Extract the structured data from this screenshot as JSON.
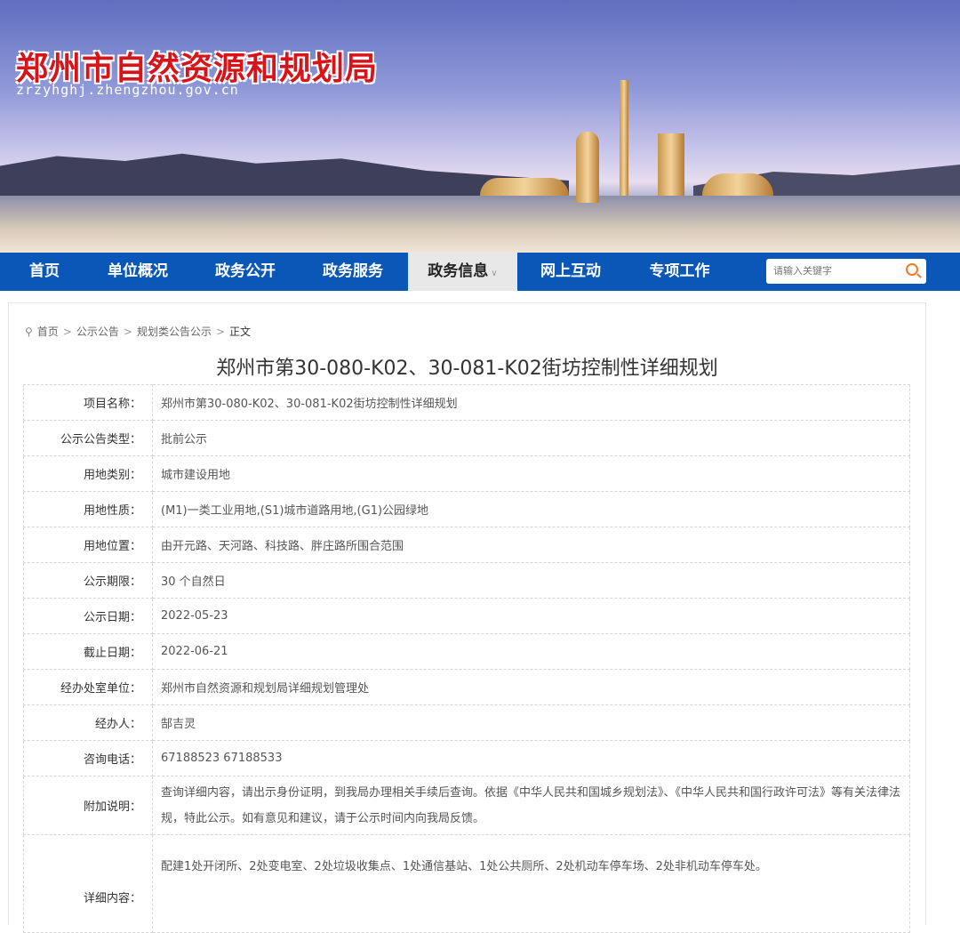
{
  "header": {
    "title": "郑州市自然资源和规划局",
    "domain": "zrzyhghj.zhengzhou.gov.cn"
  },
  "nav": {
    "items": [
      "首页",
      "单位概况",
      "政务公开",
      "政务服务",
      "政务信息",
      "网上互动",
      "专项工作"
    ],
    "search_placeholder": "请输入关键字"
  },
  "breadcrumb": [
    "首页",
    "公示公告",
    "规划类公告公示",
    "正文"
  ],
  "article": {
    "title": "郑州市第30-080-K02、30-081-K02街坊控制性详细规划",
    "rows": [
      {
        "label": "项目名称：",
        "value": "郑州市第30-080-K02、30-081-K02街坊控制性详细规划"
      },
      {
        "label": "公示公告类型：",
        "value": "批前公示"
      },
      {
        "label": "用地类别：",
        "value": "城市建设用地"
      },
      {
        "label": "用地性质：",
        "value": "(M1)一类工业用地,(S1)城市道路用地,(G1)公园绿地"
      },
      {
        "label": "用地位置：",
        "value": "由开元路、天河路、科技路、胖庄路所围合范围"
      },
      {
        "label": "公示期限：",
        "value": "30 个自然日"
      },
      {
        "label": "公示日期：",
        "value": "2022-05-23"
      },
      {
        "label": "截止日期：",
        "value": "2022-06-21"
      },
      {
        "label": "经办处室单位：",
        "value": "郑州市自然资源和规划局详细规划管理处"
      },
      {
        "label": "经办人：",
        "value": "郜吉灵"
      },
      {
        "label": "咨询电话：",
        "value": "67188523 67188533"
      },
      {
        "label": "附加说明：",
        "value": "查询详细内容，请出示身份证明，到我局办理相关手续后查询。依据《中华人民共和国城乡规划法》、《中华人民共和国行政许可法》等有关法律法规，特此公示。如有意见和建议，请于公示时间内向我局反馈。"
      },
      {
        "label": "详细内容：",
        "value": "配建1处开闭所、2处变电室、2处垃圾收集点、1处通信基站、1处公共厕所、2处机动车停车场、2处非机动车停车处。"
      }
    ]
  }
}
